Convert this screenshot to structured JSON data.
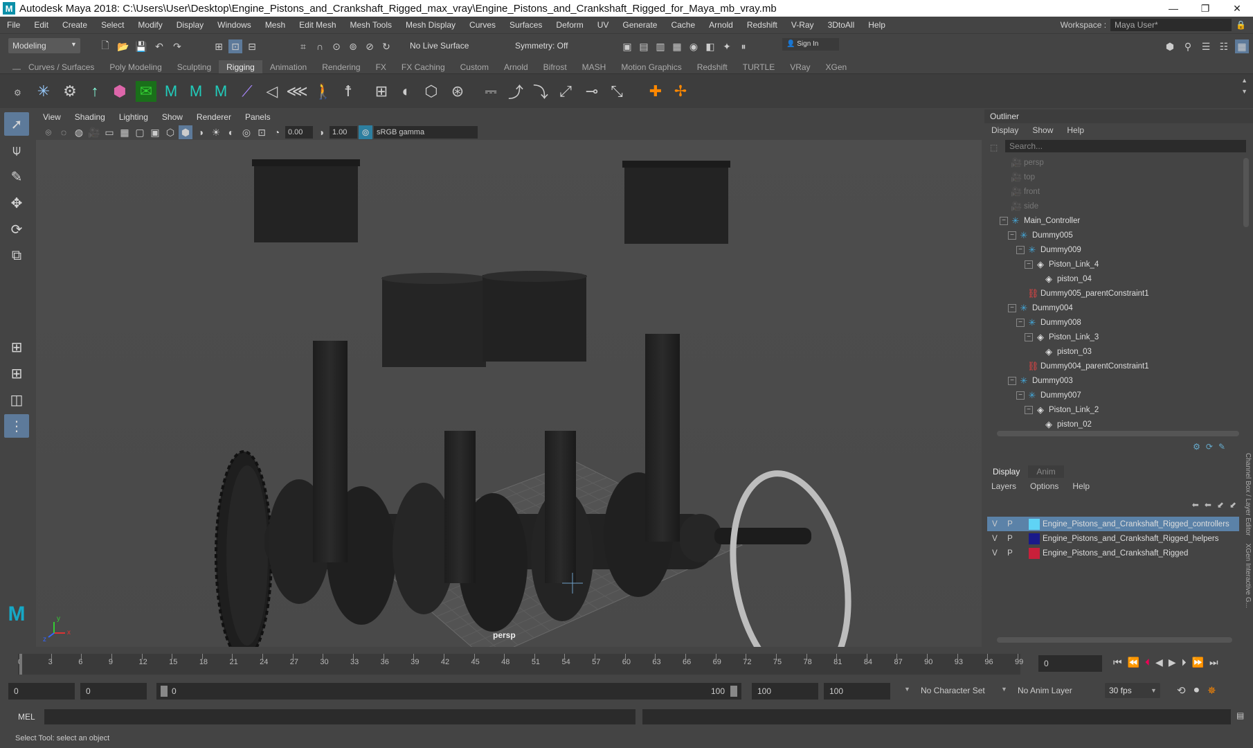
{
  "title": "Autodesk Maya 2018: C:\\Users\\User\\Desktop\\Engine_Pistons_and_Crankshaft_Rigged_max_vray\\Engine_Pistons_and_Crankshaft_Rigged_for_Maya_mb_vray.mb",
  "menubar": [
    "File",
    "Edit",
    "Create",
    "Select",
    "Modify",
    "Display",
    "Windows",
    "Mesh",
    "Edit Mesh",
    "Mesh Tools",
    "Mesh Display",
    "Curves",
    "Surfaces",
    "Deform",
    "UV",
    "Generate",
    "Cache",
    "Arnold",
    "Redshift",
    "V-Ray",
    "3DtoAll",
    "Help"
  ],
  "workspace": {
    "label": "Workspace :",
    "value": "Maya User*"
  },
  "status": {
    "mode": "Modeling",
    "live_surface": "No Live Surface",
    "symmetry": "Symmetry: Off",
    "sign_in": "Sign In"
  },
  "shelf_tabs": [
    "Curves / Surfaces",
    "Poly Modeling",
    "Sculpting",
    "Rigging",
    "Animation",
    "Rendering",
    "FX",
    "FX Caching",
    "Custom",
    "Arnold",
    "Bifrost",
    "MASH",
    "Motion Graphics",
    "Redshift",
    "TURTLE",
    "VRay",
    "XGen"
  ],
  "shelf_active": "Rigging",
  "viewport": {
    "menus": [
      "View",
      "Shading",
      "Lighting",
      "Show",
      "Renderer",
      "Panels"
    ],
    "exposure": "0.00",
    "gamma": "1.00",
    "colorspace": "sRGB gamma",
    "camera_label": "persp",
    "axis_x": "x",
    "axis_y": "y",
    "axis_z": "z"
  },
  "outliner": {
    "title": "Outliner",
    "menus": [
      "Display",
      "Show",
      "Help"
    ],
    "search_placeholder": "Search...",
    "rows": [
      {
        "label": "persp",
        "indent": 0,
        "icon": "camera-icon",
        "dim": true
      },
      {
        "label": "top",
        "indent": 0,
        "icon": "camera-icon",
        "dim": true
      },
      {
        "label": "front",
        "indent": 0,
        "icon": "camera-icon",
        "dim": true
      },
      {
        "label": "side",
        "indent": 0,
        "icon": "camera-icon",
        "dim": true
      },
      {
        "label": "Main_Controller",
        "indent": 0,
        "icon": "locator-icon",
        "toggle": "−"
      },
      {
        "label": "Dummy005",
        "indent": 1,
        "icon": "locator-icon",
        "toggle": "−"
      },
      {
        "label": "Dummy009",
        "indent": 2,
        "icon": "locator-icon",
        "toggle": "−"
      },
      {
        "label": "Piston_Link_4",
        "indent": 3,
        "icon": "mesh-icon",
        "toggle": "−"
      },
      {
        "label": "piston_04",
        "indent": 4,
        "icon": "mesh-icon"
      },
      {
        "label": "Dummy005_parentConstraint1",
        "indent": 2,
        "icon": "constraint-icon"
      },
      {
        "label": "Dummy004",
        "indent": 1,
        "icon": "locator-icon",
        "toggle": "−"
      },
      {
        "label": "Dummy008",
        "indent": 2,
        "icon": "locator-icon",
        "toggle": "−"
      },
      {
        "label": "Piston_Link_3",
        "indent": 3,
        "icon": "mesh-icon",
        "toggle": "−"
      },
      {
        "label": "piston_03",
        "indent": 4,
        "icon": "mesh-icon"
      },
      {
        "label": "Dummy004_parentConstraint1",
        "indent": 2,
        "icon": "constraint-icon"
      },
      {
        "label": "Dummy003",
        "indent": 1,
        "icon": "locator-icon",
        "toggle": "−"
      },
      {
        "label": "Dummy007",
        "indent": 2,
        "icon": "locator-icon",
        "toggle": "−"
      },
      {
        "label": "Piston_Link_2",
        "indent": 3,
        "icon": "mesh-icon",
        "toggle": "−"
      },
      {
        "label": "piston_02",
        "indent": 4,
        "icon": "mesh-icon"
      }
    ]
  },
  "channel_box": {
    "tabs": [
      "Display",
      "Anim"
    ],
    "menus": [
      "Layers",
      "Options",
      "Help"
    ],
    "side_label": "Channel Box / Layer Editor",
    "side_label2": "XGen Interactive G...",
    "layers": [
      {
        "v": "V",
        "p": "P",
        "color": "#5fd3f5",
        "name": "Engine_Pistons_and_Crankshaft_Rigged_controllers",
        "selected": true
      },
      {
        "v": "V",
        "p": "P",
        "color": "#1a1a8a",
        "name": "Engine_Pistons_and_Crankshaft_Rigged_helpers",
        "selected": false
      },
      {
        "v": "V",
        "p": "P",
        "color": "#c8203a",
        "name": "Engine_Pistons_and_Crankshaft_Rigged",
        "selected": false
      }
    ]
  },
  "timeline": {
    "ticks": [
      "0",
      "3",
      "6",
      "9",
      "12",
      "15",
      "18",
      "21",
      "24",
      "27",
      "30",
      "33",
      "36",
      "39",
      "42",
      "45",
      "48",
      "51",
      "54",
      "57",
      "60",
      "63",
      "66",
      "69",
      "72",
      "75",
      "78",
      "81",
      "84",
      "87",
      "90",
      "93",
      "96",
      "99"
    ],
    "current_frame": "0"
  },
  "range": {
    "start": "0",
    "start2": "0",
    "slider_start": "0",
    "slider_end": "100",
    "end": "100",
    "end2": "100",
    "character_set": "No Character Set",
    "anim_layer": "No Anim Layer",
    "fps": "30 fps"
  },
  "cmdline": {
    "label": "MEL"
  },
  "help_line": "Select Tool: select an object",
  "colors": {
    "accent": "#5b82a8",
    "highlight_blue": "#5fd3f5",
    "maya_teal": "#0b8fa8"
  }
}
